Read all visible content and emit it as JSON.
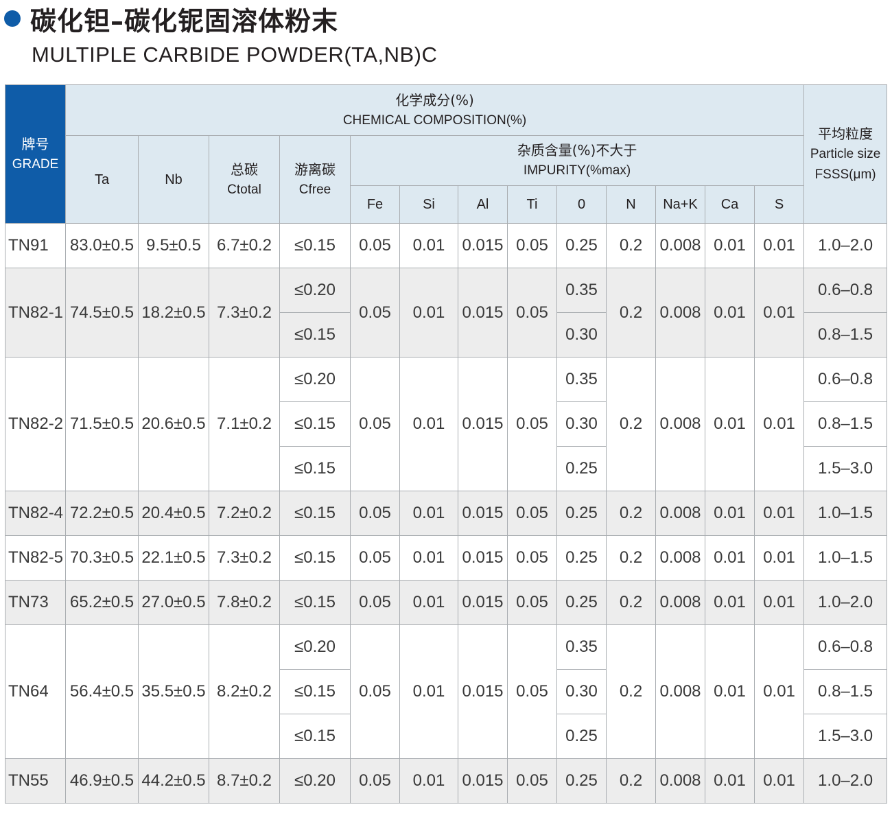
{
  "header": {
    "title_zh": "碳化钽–碳化铌固溶体粉末",
    "title_en": "MULTIPLE CARBIDE POWDER(TA,NB)C"
  },
  "table": {
    "headers": {
      "grade_zh": "牌号",
      "grade_en": "GRADE",
      "chem_zh": "化学成分(%)",
      "chem_en": "CHEMICAL COMPOSITION(%)",
      "ta": "Ta",
      "nb": "Nb",
      "ctotal_zh": "总碳",
      "ctotal_en": "Ctotal",
      "cfree_zh": "游离碳",
      "cfree_en": "Cfree",
      "impurity_zh": "杂质含量(%)不大于",
      "impurity_en": "IMPURITY(%max)",
      "fe": "Fe",
      "si": "Si",
      "al": "Al",
      "ti": "Ti",
      "o": "0",
      "n": "N",
      "nak": "Na+K",
      "ca": "Ca",
      "s": "S",
      "particle_zh": "平均粒度",
      "particle_en": "Particle size",
      "particle_unit": "FSSS(μm)"
    },
    "common": {
      "fe": "0.05",
      "si": "0.01",
      "al": "0.015",
      "ti": "0.05",
      "n": "0.2",
      "nak": "0.008",
      "ca": "0.01",
      "s": "0.01"
    },
    "rows": [
      {
        "grade": "TN91",
        "ta": "83.0±0.5",
        "nb": "9.5±0.5",
        "ctotal": "6.7±0.2",
        "cfree": [
          "≤0.15"
        ],
        "o": [
          "0.25"
        ],
        "size": [
          "1.0–2.0"
        ]
      },
      {
        "grade": "TN82-1",
        "ta": "74.5±0.5",
        "nb": "18.2±0.5",
        "ctotal": "7.3±0.2",
        "cfree": [
          "≤0.20",
          "≤0.15"
        ],
        "o": [
          "0.35",
          "0.30"
        ],
        "size": [
          "0.6–0.8",
          "0.8–1.5"
        ]
      },
      {
        "grade": "TN82-2",
        "ta": "71.5±0.5",
        "nb": "20.6±0.5",
        "ctotal": "7.1±0.2",
        "cfree": [
          "≤0.20",
          "≤0.15",
          "≤0.15"
        ],
        "o": [
          "0.35",
          "0.30",
          "0.25"
        ],
        "size": [
          "0.6–0.8",
          "0.8–1.5",
          "1.5–3.0"
        ]
      },
      {
        "grade": "TN82-4",
        "ta": "72.2±0.5",
        "nb": "20.4±0.5",
        "ctotal": "7.2±0.2",
        "cfree": [
          "≤0.15"
        ],
        "o": [
          "0.25"
        ],
        "size": [
          "1.0–1.5"
        ]
      },
      {
        "grade": "TN82-5",
        "ta": "70.3±0.5",
        "nb": "22.1±0.5",
        "ctotal": "7.3±0.2",
        "cfree": [
          "≤0.15"
        ],
        "o": [
          "0.25"
        ],
        "size": [
          "1.0–1.5"
        ]
      },
      {
        "grade": "TN73",
        "ta": "65.2±0.5",
        "nb": "27.0±0.5",
        "ctotal": "7.8±0.2",
        "cfree": [
          "≤0.15"
        ],
        "o": [
          "0.25"
        ],
        "size": [
          "1.0–2.0"
        ]
      },
      {
        "grade": "TN64",
        "ta": "56.4±0.5",
        "nb": "35.5±0.5",
        "ctotal": "8.2±0.2",
        "cfree": [
          "≤0.20",
          "≤0.15",
          "≤0.15"
        ],
        "o": [
          "0.35",
          "0.30",
          "0.25"
        ],
        "size": [
          "0.6–0.8",
          "0.8–1.5",
          "1.5–3.0"
        ]
      },
      {
        "grade": "TN55",
        "ta": "46.9±0.5",
        "nb": "44.2±0.5",
        "ctotal": "8.7±0.2",
        "cfree": [
          "≤0.20"
        ],
        "o": [
          "0.25"
        ],
        "size": [
          "1.0–2.0"
        ]
      }
    ]
  }
}
